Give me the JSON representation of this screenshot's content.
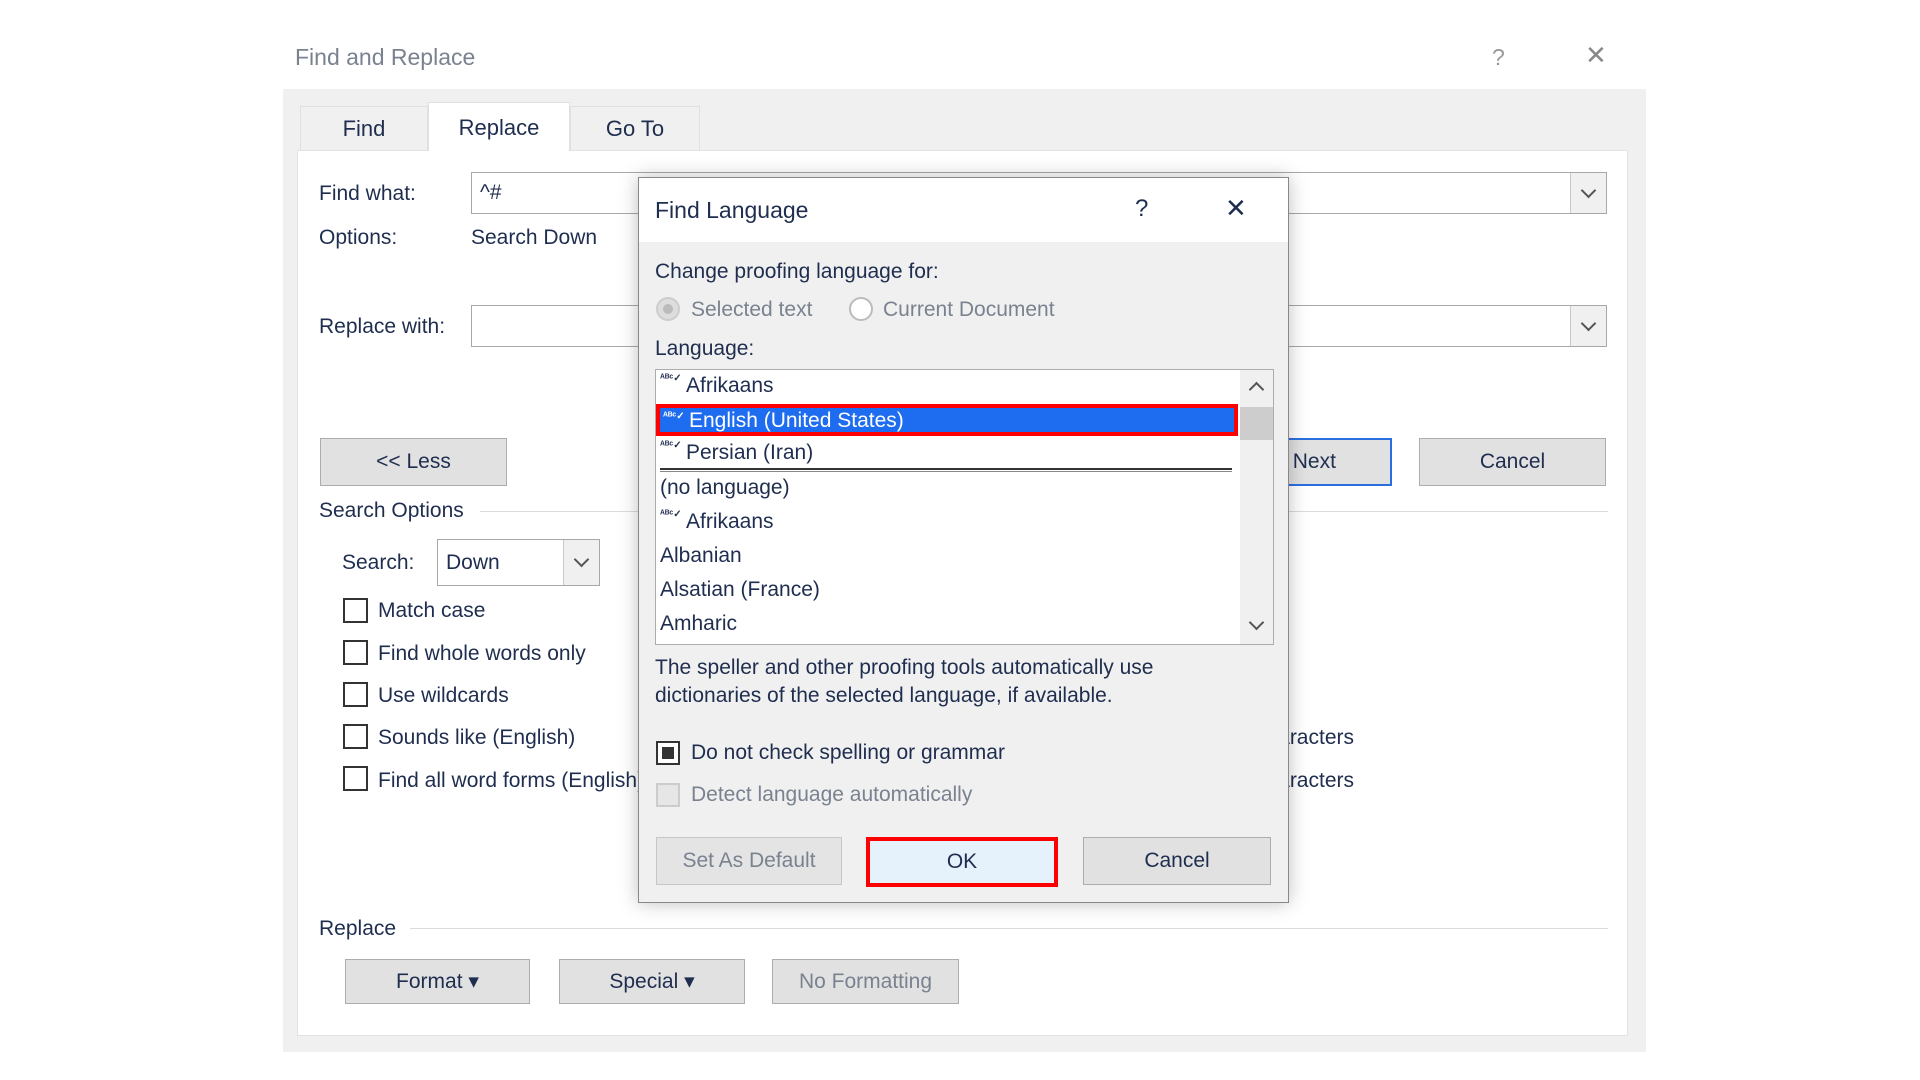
{
  "window": {
    "title": "Find and Replace",
    "help": "?",
    "close": "✕"
  },
  "tabs": [
    {
      "label": "Find",
      "active": false
    },
    {
      "label": "Replace",
      "active": true
    },
    {
      "label": "Go To",
      "active": false
    }
  ],
  "find_what": {
    "label": "Find what:",
    "value": "^#"
  },
  "options": {
    "label": "Options:",
    "value": "Search Down"
  },
  "replace_with": {
    "label": "Replace with:",
    "value": ""
  },
  "buttons": {
    "less": "<< Less",
    "find_next": "Find Next",
    "cancel": "Cancel"
  },
  "search_options": {
    "title": "Search Options",
    "search_label": "Search:",
    "search_value": "Down",
    "checkboxes": [
      {
        "label": "Match case",
        "checked": false
      },
      {
        "label": "Find whole words only",
        "checked": false
      },
      {
        "label": "Use wildcards",
        "checked": false
      },
      {
        "label": "Sounds like (English)",
        "checked": false
      },
      {
        "label": "Find all word forms (English)",
        "checked": false
      }
    ],
    "right_checkboxes": [
      {
        "label": "Ignore punctuation characters"
      },
      {
        "label": "Ignore white-space characters"
      }
    ]
  },
  "replace_section": {
    "title": "Replace",
    "format": "Format ▾",
    "special": "Special ▾",
    "no_formatting": "No Formatting"
  },
  "find_language": {
    "title": "Find Language",
    "help": "?",
    "close": "✕",
    "change_label": "Change proofing language for:",
    "radios": [
      {
        "label": "Selected text",
        "selected": true,
        "disabled": true
      },
      {
        "label": "Current Document",
        "selected": false
      }
    ],
    "language_label": "Language:",
    "languages": [
      {
        "label": "Afrikaans",
        "spell_icon": true,
        "selected": false
      },
      {
        "label": "English (United States)",
        "spell_icon": true,
        "selected": true
      },
      {
        "label": "Persian (Iran)",
        "spell_icon": true,
        "selected": false
      },
      {
        "label": "(no language)",
        "spell_icon": false,
        "selected": false
      },
      {
        "label": "Afrikaans",
        "spell_icon": true,
        "selected": false
      },
      {
        "label": "Albanian",
        "spell_icon": false,
        "selected": false
      },
      {
        "label": "Alsatian (France)",
        "spell_icon": false,
        "selected": false
      },
      {
        "label": "Amharic",
        "spell_icon": false,
        "selected": false
      }
    ],
    "description_line1": "The speller and other proofing tools automatically use",
    "description_line2": "dictionaries of the selected language, if available.",
    "no_check": {
      "label": "Do not check spelling or grammar",
      "checked": true
    },
    "detect": {
      "label": "Detect language automatically",
      "checked": false,
      "disabled": true
    },
    "set_default": "Set As Default",
    "ok": "OK",
    "cancel": "Cancel",
    "highlight_color": "#ff0000",
    "selection_color": "#1e6cf0"
  }
}
